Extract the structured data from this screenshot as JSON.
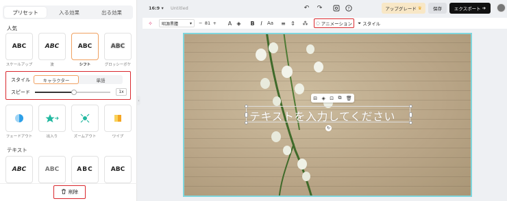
{
  "left_panel": {
    "tabs": [
      {
        "label": "プリセット"
      },
      {
        "label": "入る効果"
      },
      {
        "label": "出る効果"
      }
    ],
    "popular_title": "人気",
    "popular": [
      {
        "preview": "ABC",
        "label": "スケールアップ"
      },
      {
        "preview": "ABC",
        "label": "波"
      },
      {
        "preview": "ABC",
        "label": "シフト"
      },
      {
        "preview": "ABC",
        "label": "グロッシーボケ"
      }
    ],
    "style_label": "スタイル",
    "style_options": [
      "キャラクター",
      "単語"
    ],
    "speed_label": "スピード",
    "speed_value": "1x",
    "speed_fraction": 0.52,
    "effects": [
      {
        "label": "フェードアウト"
      },
      {
        "label": "出入り"
      },
      {
        "label": "ズームアウト"
      },
      {
        "label": "ワイプ"
      }
    ],
    "text_title": "テキスト",
    "text_presets": [
      {
        "preview": "ABC"
      },
      {
        "preview": "ABC"
      },
      {
        "preview": "ABC"
      },
      {
        "preview": "ABC"
      }
    ],
    "delete_label": "削除"
  },
  "topbar": {
    "ratio": "16:9",
    "ratio_arrow": "▾",
    "doc_title": "Untitled",
    "upgrade_label": "アップグレード",
    "save_label": "保存",
    "export_label": "エクスポート"
  },
  "toolbar": {
    "font_name": "昭源黒體",
    "font_size": "81",
    "animation_label": "アニメーション",
    "style_label": "スタイル"
  },
  "canvas": {
    "text": "テキストを入力してください"
  },
  "colors": {
    "accent_red": "#d9262c",
    "selected_orange": "#f0a060",
    "canvas_border": "#7fd6dd",
    "export_bg": "#111111"
  }
}
